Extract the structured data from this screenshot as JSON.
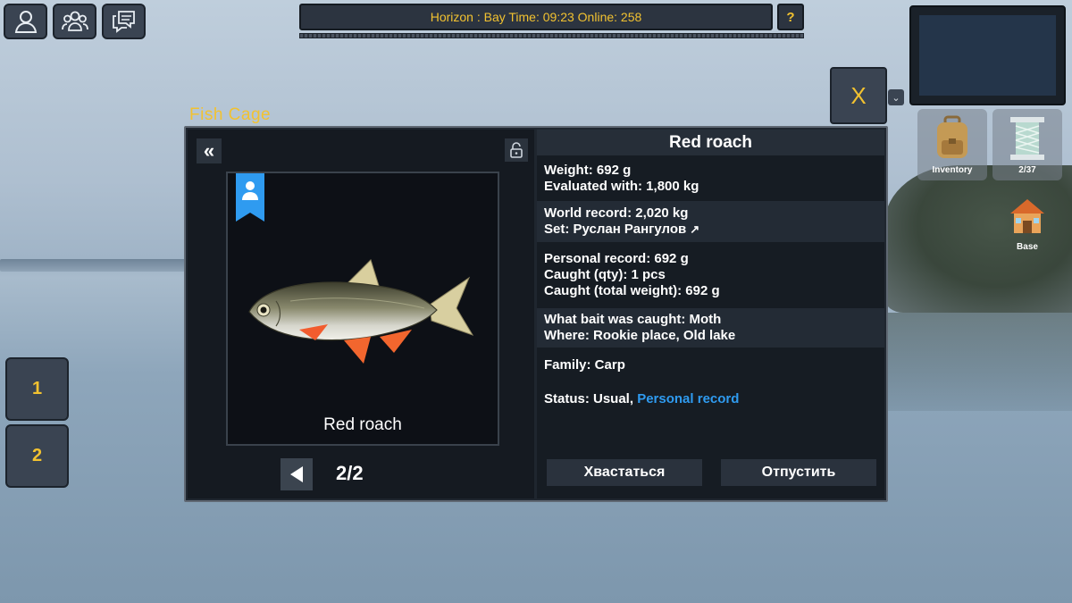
{
  "hud": {
    "status_text": "Horizon : Bay Time: 09:23 Online: 258",
    "help_label": "?",
    "close_label": "X",
    "dropdown_label": "⌄",
    "hotbar": [
      "1",
      "2"
    ],
    "inventory_label": "Inventory",
    "line_count": "2/37",
    "base_label": "Base"
  },
  "dialog": {
    "window_title": "Fish Cage",
    "back_label": "«",
    "fish_name": "Red roach",
    "page": "2/2",
    "info": {
      "weight": "Weight: 692 g",
      "evaluated": "Evaluated with: 1,800 kg",
      "world_record": "World record: 2,020 kg",
      "set_by": "Set: Руслан Рангулов",
      "set_arrow": "↗",
      "personal_record": "Personal record: 692 g",
      "caught_qty": "Caught (qty): 1 pcs",
      "caught_total": "Caught (total weight): 692 g",
      "bait": "What bait was caught: Moth",
      "where": "Where: Rookie place, Old lake",
      "family": "Family: Carp",
      "status_prefix": "Status: Usual,",
      "status_link": "Personal record"
    },
    "buttons": {
      "brag": "Хвастаться",
      "release": "Отпустить"
    }
  },
  "colors": {
    "accent_yellow": "#f2c230",
    "link_blue": "#2f9bf0",
    "panel_dark": "#161c23"
  }
}
